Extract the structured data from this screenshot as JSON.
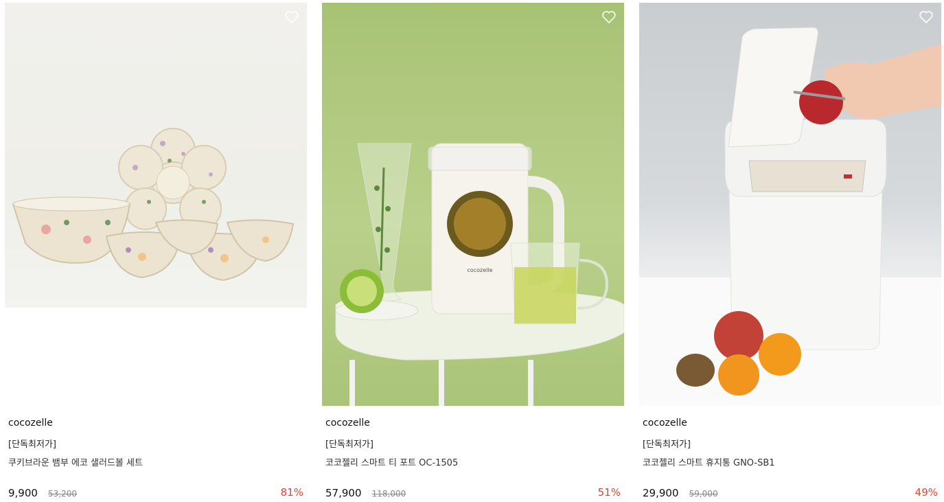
{
  "products": [
    {
      "brand": "cocozelle",
      "tag": "[단독최저가]",
      "name": "쿠키브라운 뱀부 에코 샐러드볼 세트",
      "price": "9,900",
      "original_price": "53,200",
      "discount": "81%",
      "wishlist_icon": "heart-outline-icon",
      "image": "salad-bowl-set-photo"
    },
    {
      "brand": "cocozelle",
      "tag": "[단독최저가]",
      "name": "코코젤리 스마트 티 포트 OC-1505",
      "price": "57,900",
      "original_price": "118,000",
      "discount": "51%",
      "wishlist_icon": "heart-outline-icon",
      "image": "smart-tea-pot-photo"
    },
    {
      "brand": "cocozelle",
      "tag": "[단독최저가]",
      "name": "코코젤리 스마트 휴지통 GNO-SB1",
      "price": "29,900",
      "original_price": "59,000",
      "discount": "49%",
      "wishlist_icon": "heart-outline-icon",
      "image": "smart-trash-bin-photo"
    }
  ],
  "colors": {
    "discount": "#e5432e",
    "original_price": "#888888"
  },
  "pot_brand_label": "cocozelle"
}
